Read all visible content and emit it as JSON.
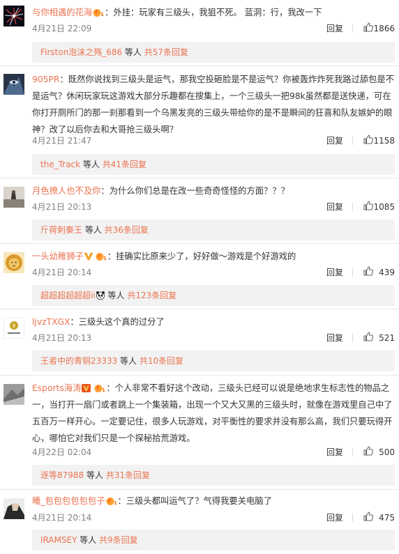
{
  "comments": [
    {
      "user": "与你相遇的花海",
      "body": "：外挂：玩家有三级头，我狙不死。 蓝洞：行，我改一下",
      "time": "4月21日 22:09",
      "reply_label": "回复",
      "likes": "1866",
      "sub_user": "Firston泡沫之殇_686",
      "sub_mid": " 等人 ",
      "sub_count": "共57条回复"
    },
    {
      "user": "905PR",
      "body": "：既然你说找到三级头是运气，那我空投砸脸是不是运气？你被轰炸炸死我路过舔包是不是运气？休闲玩家玩这游戏大部分乐趣都在搜集上，一个三级头一把98k虽然都是送快递，可在你打开厕所门的那一刹那看到一个乌黑发亮的三级头带给你的是不是瞬间的狂喜和队友嫉妒的眼神？改了以后你去和大哥抢三级头啊？",
      "time": "4月21日 21:47",
      "reply_label": "回复",
      "likes": "1158",
      "sub_user": "the_Track",
      "sub_mid": " 等人 ",
      "sub_count": "共41条回复"
    },
    {
      "user": "月色撩人也不及你",
      "body": "：为什么你们总是在改一些奇奇怪怪的方面？？？",
      "time": "4月21日 20:13",
      "reply_label": "回复",
      "likes": "1085",
      "sub_user": "斤荷刺秦王",
      "sub_mid": " 等人 ",
      "sub_count": "共36条回复"
    },
    {
      "user": "一头幼稚狮子",
      "body": "：挂确实比原来少了，好好做～游戏是个好游戏的",
      "time": "4月21日 20:14",
      "reply_label": "回复",
      "likes": "439",
      "sub_user": "超超超超超超ii",
      "sub_mid": " 等人 ",
      "sub_count": "共123条回复"
    },
    {
      "user": "ljvzTXGX",
      "body": "：三级头这个真的过分了",
      "time": "4月21日 20:13",
      "reply_label": "回复",
      "likes": "521",
      "sub_user": "王者中的青铜23333",
      "sub_mid": " 等人 ",
      "sub_count": "共10条回复"
    },
    {
      "user": "Esports海涛",
      "body": "：个人非常不看好这个改动，三级头已经可以说是绝地求生标志性的物品之一，当打开一扇门或者跳上一个集装箱，出现一个又大又黑的三级头时，就像在游戏里自己中了五百万一样开心。一定要记住，很多人玩游戏，对平衡性的要求并没有那么高，我们只要玩得开心，哪怕它对我们只是一个探秘拾荒游戏。",
      "time": "4月22日 02:04",
      "reply_label": "回复",
      "likes": "500",
      "sub_user": "逐等87988",
      "sub_mid": " 等人 ",
      "sub_count": "共31条回复"
    },
    {
      "user": "曦_包包包包包包子",
      "body": "：三级头都叫运气了？气得我要关电脑了",
      "time": "4月21日 20:14",
      "reply_label": "回复",
      "likes": "475",
      "sub_user": "IRAMSEY",
      "sub_mid": " 等人 ",
      "sub_count": "共9条回复"
    }
  ],
  "colors": {
    "username": "#eb7350",
    "text": "#333333",
    "meta": "#808080",
    "subbox_bg": "#f2f2f2",
    "divider": "#e6e6e6"
  },
  "icons": {
    "like": "thumbs-up-icon",
    "flame_badge": "flame-badge-icon",
    "vip_badge": "vip-v-icon",
    "panda_emoji": "panda-emoji-icon"
  }
}
